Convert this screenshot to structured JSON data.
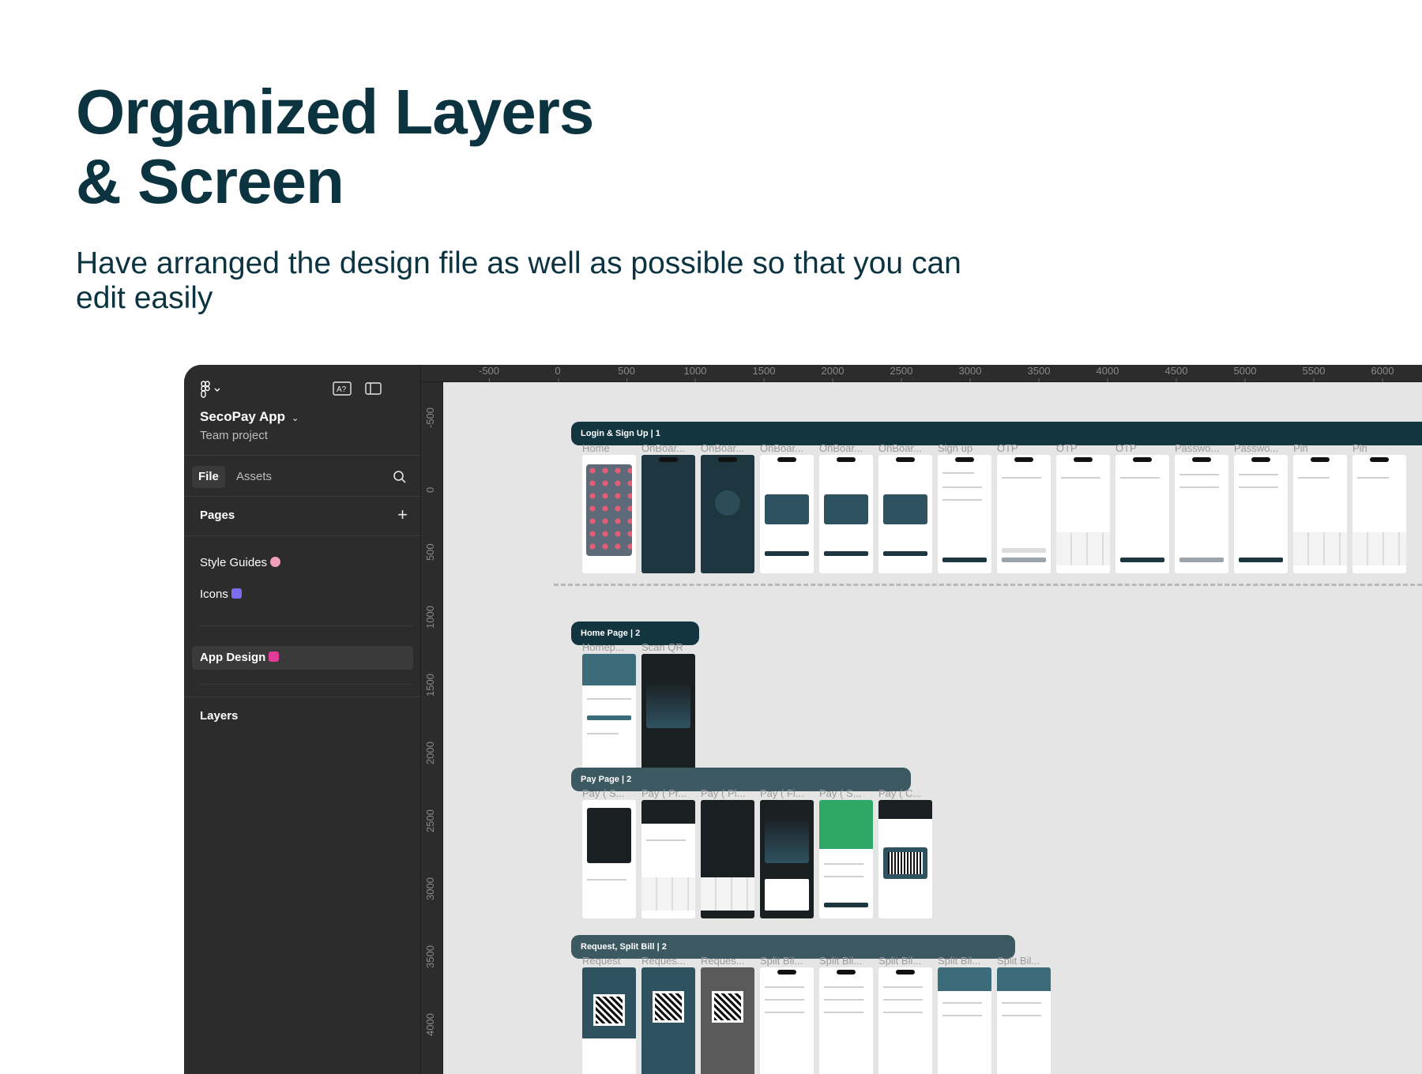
{
  "hero": {
    "title_line1": "Organized Layers",
    "title_line2": "& Screen",
    "subtitle": "Have arranged the design file as well as possible so that you can edit easily"
  },
  "colors": {
    "heading": "#0b3340",
    "panel": "#2c2c2c",
    "canvas": "#e5e5e5",
    "section_dark": "#133540",
    "section_mid": "#3c5962"
  },
  "sidebar": {
    "logo_icon": "figma-logo-icon",
    "project_name": "SecoPay App",
    "project_type": "Team project",
    "tabs": [
      {
        "label": "File"
      },
      {
        "label": "Assets"
      }
    ],
    "pages_label": "Pages",
    "pages": [
      {
        "label": "Style Guides",
        "emoji_color": "#f0a0b8"
      },
      {
        "label": "Icons",
        "emoji_color": "#7b6cf0"
      },
      {
        "label": "App Design",
        "emoji_color": "#e33c98"
      }
    ],
    "layers_label": "Layers"
  },
  "rulers": {
    "top": [
      "-500",
      "0",
      "500",
      "1000",
      "1500",
      "2000",
      "2500",
      "3000",
      "3500",
      "4000",
      "4500",
      "5000",
      "5500",
      "6000"
    ],
    "left": [
      "-500",
      "0",
      "500",
      "1000",
      "1500",
      "2000",
      "2500",
      "3000",
      "3500",
      "4000"
    ]
  },
  "sections": [
    {
      "title": "Login & Sign Up | 1",
      "frames": [
        "Home",
        "OnBoar...",
        "OnBoar...",
        "OnBoar...",
        "OnBoar...",
        "OnBoar...",
        "Sign up",
        "OTP",
        "OTP",
        "OTP",
        "Passwo...",
        "Passwo...",
        "Pin",
        "Pin"
      ]
    },
    {
      "title": "Home Page | 2",
      "frames": [
        "Homep...",
        "Scan QR"
      ]
    },
    {
      "title": "Pay Page | 2",
      "frames": [
        "Pay ( S...",
        "Pay ( Pr...",
        "Pay ( Pl...",
        "Pay ( Fi...",
        "Pay ( S...",
        "Pay ( C..."
      ]
    },
    {
      "title": "Request, Split Bill | 2",
      "frames": [
        "Request",
        "Reques...",
        "Reques...",
        "Split Bil...",
        "Split Bil...",
        "Split Bil...",
        "Split Bil...",
        "Split Bil..."
      ]
    }
  ]
}
